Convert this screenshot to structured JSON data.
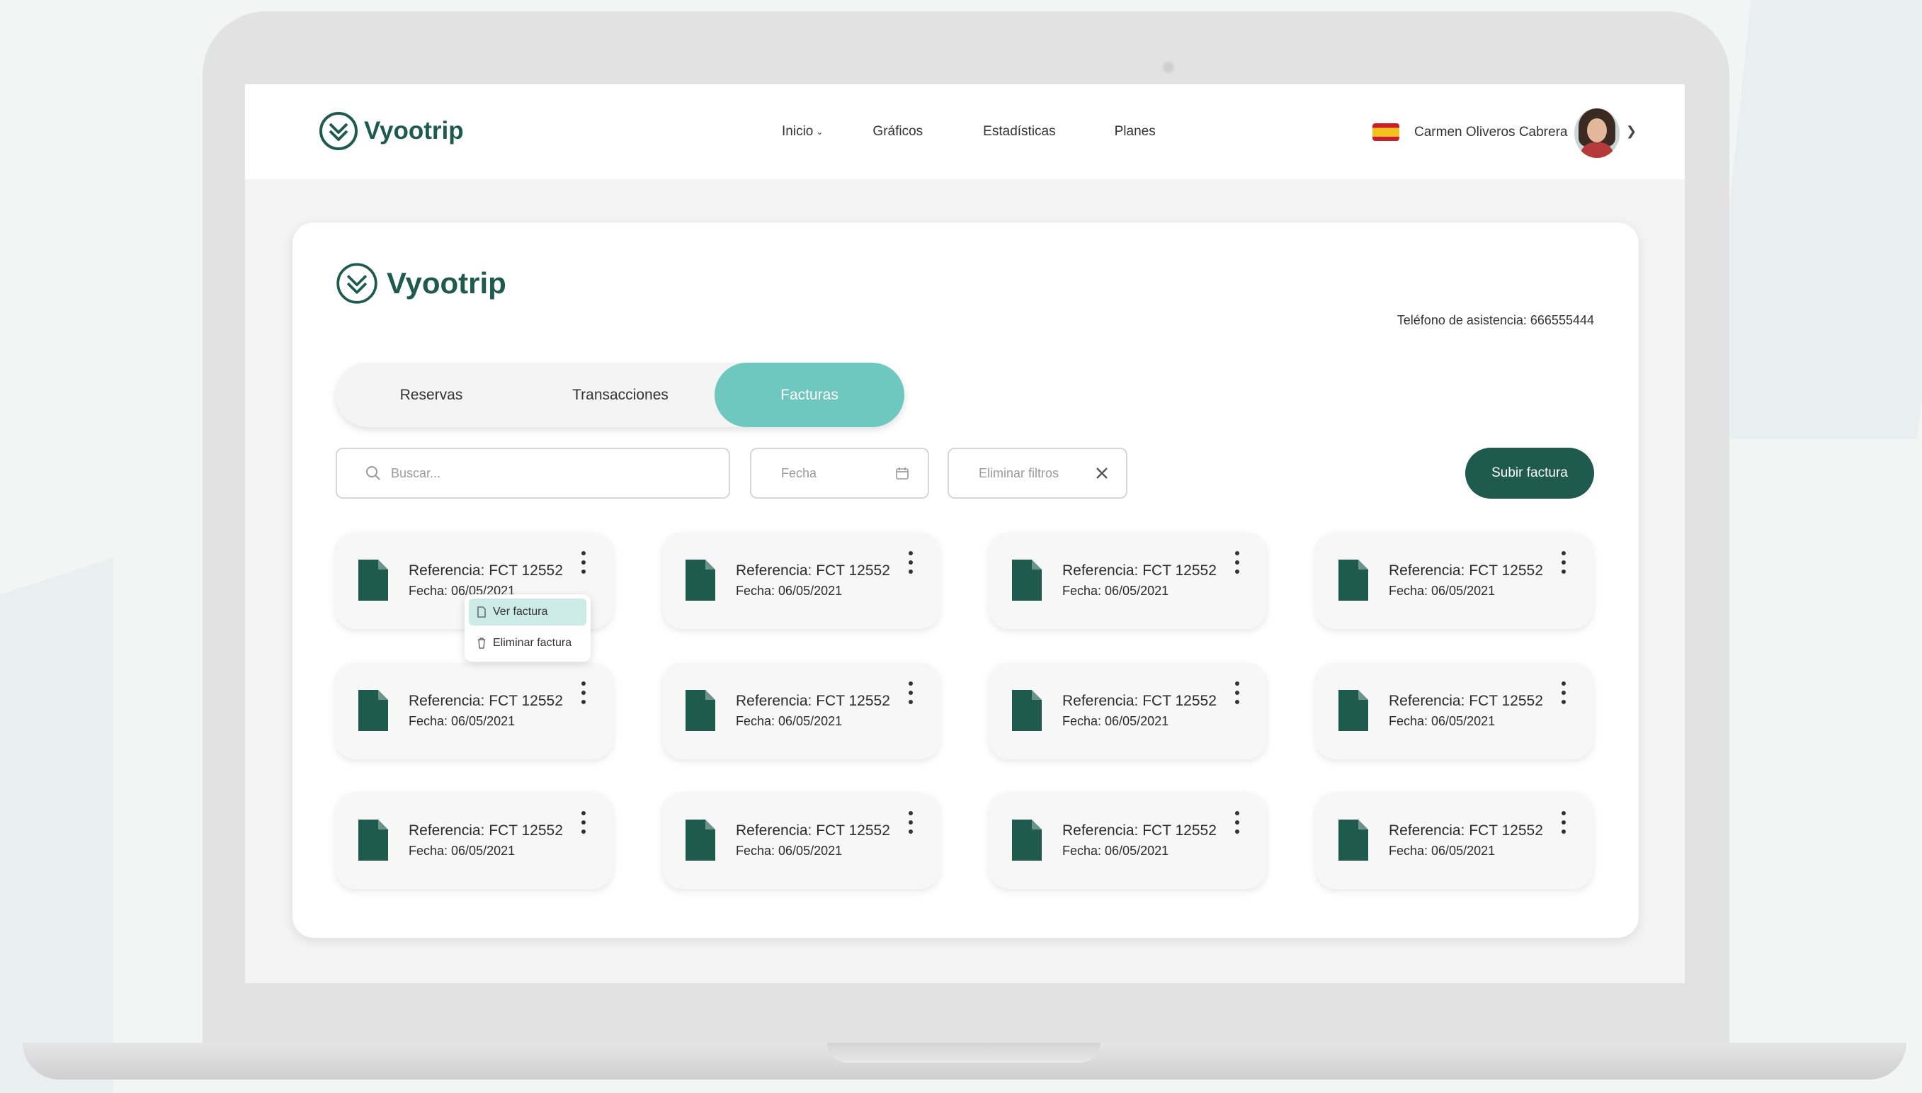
{
  "brand": {
    "name": "Vyootrip",
    "color": "#1e5a4e",
    "accent": "#6ec8bf"
  },
  "nav": {
    "items": [
      {
        "label": "Inicio"
      },
      {
        "label": "Gráficos"
      },
      {
        "label": "Estadísticas"
      },
      {
        "label": "Planes"
      }
    ],
    "user_name": "Carmen Oliveros Cabrera",
    "flag": "spain-flag-icon"
  },
  "card": {
    "phone": "Teléfono de asistencia: 666555444",
    "tabs": [
      {
        "label": "Reservas",
        "active": false
      },
      {
        "label": "Transacciones",
        "active": false
      },
      {
        "label": "Facturas",
        "active": true
      }
    ],
    "search_placeholder": "Buscar...",
    "date_placeholder": "Fecha",
    "clear_filters": "Eliminar filtros",
    "upload_label": "Subir factura"
  },
  "invoices": [
    {
      "ref": "Referencia: FCT 12552",
      "date": "Fecha: 06/05/2021"
    },
    {
      "ref": "Referencia: FCT 12552",
      "date": "Fecha: 06/05/2021"
    },
    {
      "ref": "Referencia: FCT 12552",
      "date": "Fecha: 06/05/2021"
    },
    {
      "ref": "Referencia: FCT 12552",
      "date": "Fecha: 06/05/2021"
    },
    {
      "ref": "Referencia: FCT 12552",
      "date": "Fecha: 06/05/2021"
    },
    {
      "ref": "Referencia: FCT 12552",
      "date": "Fecha: 06/05/2021"
    },
    {
      "ref": "Referencia: FCT 12552",
      "date": "Fecha: 06/05/2021"
    },
    {
      "ref": "Referencia: FCT 12552",
      "date": "Fecha: 06/05/2021"
    },
    {
      "ref": "Referencia: FCT 12552",
      "date": "Fecha: 06/05/2021"
    },
    {
      "ref": "Referencia: FCT 12552",
      "date": "Fecha: 06/05/2021"
    },
    {
      "ref": "Referencia: FCT 12552",
      "date": "Fecha: 06/05/2021"
    },
    {
      "ref": "Referencia: FCT 12552",
      "date": "Fecha: 06/05/2021"
    }
  ],
  "context_menu": {
    "view": "Ver factura",
    "delete": "Eliminar factura"
  }
}
